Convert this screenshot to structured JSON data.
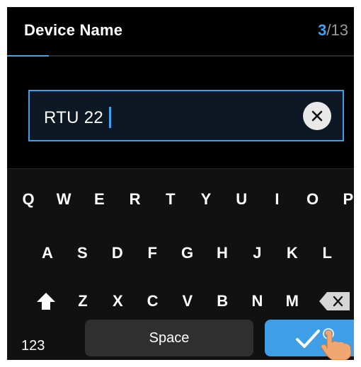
{
  "header": {
    "title": "Device Name",
    "step_current": "3",
    "step_total": "/13",
    "progress_fraction": 0.12
  },
  "input": {
    "value": "RTU 22",
    "clear_icon": "close-icon"
  },
  "keyboard": {
    "row1": [
      "Q",
      "W",
      "E",
      "R",
      "T",
      "Y",
      "U",
      "I",
      "O",
      "P"
    ],
    "row2": [
      "A",
      "S",
      "D",
      "F",
      "G",
      "H",
      "J",
      "K",
      "L"
    ],
    "row3": [
      "Z",
      "X",
      "C",
      "V",
      "B",
      "N",
      "M"
    ],
    "shift_icon": "shift-arrow-icon",
    "backspace_icon": "backspace-icon",
    "numbers_label": "123",
    "space_label": "Space",
    "confirm_icon": "checkmark-icon"
  },
  "colors": {
    "accent": "#3ea3f0",
    "background": "#000000",
    "keyboard_bg": "#111111",
    "space_key": "#2f2f2f"
  }
}
